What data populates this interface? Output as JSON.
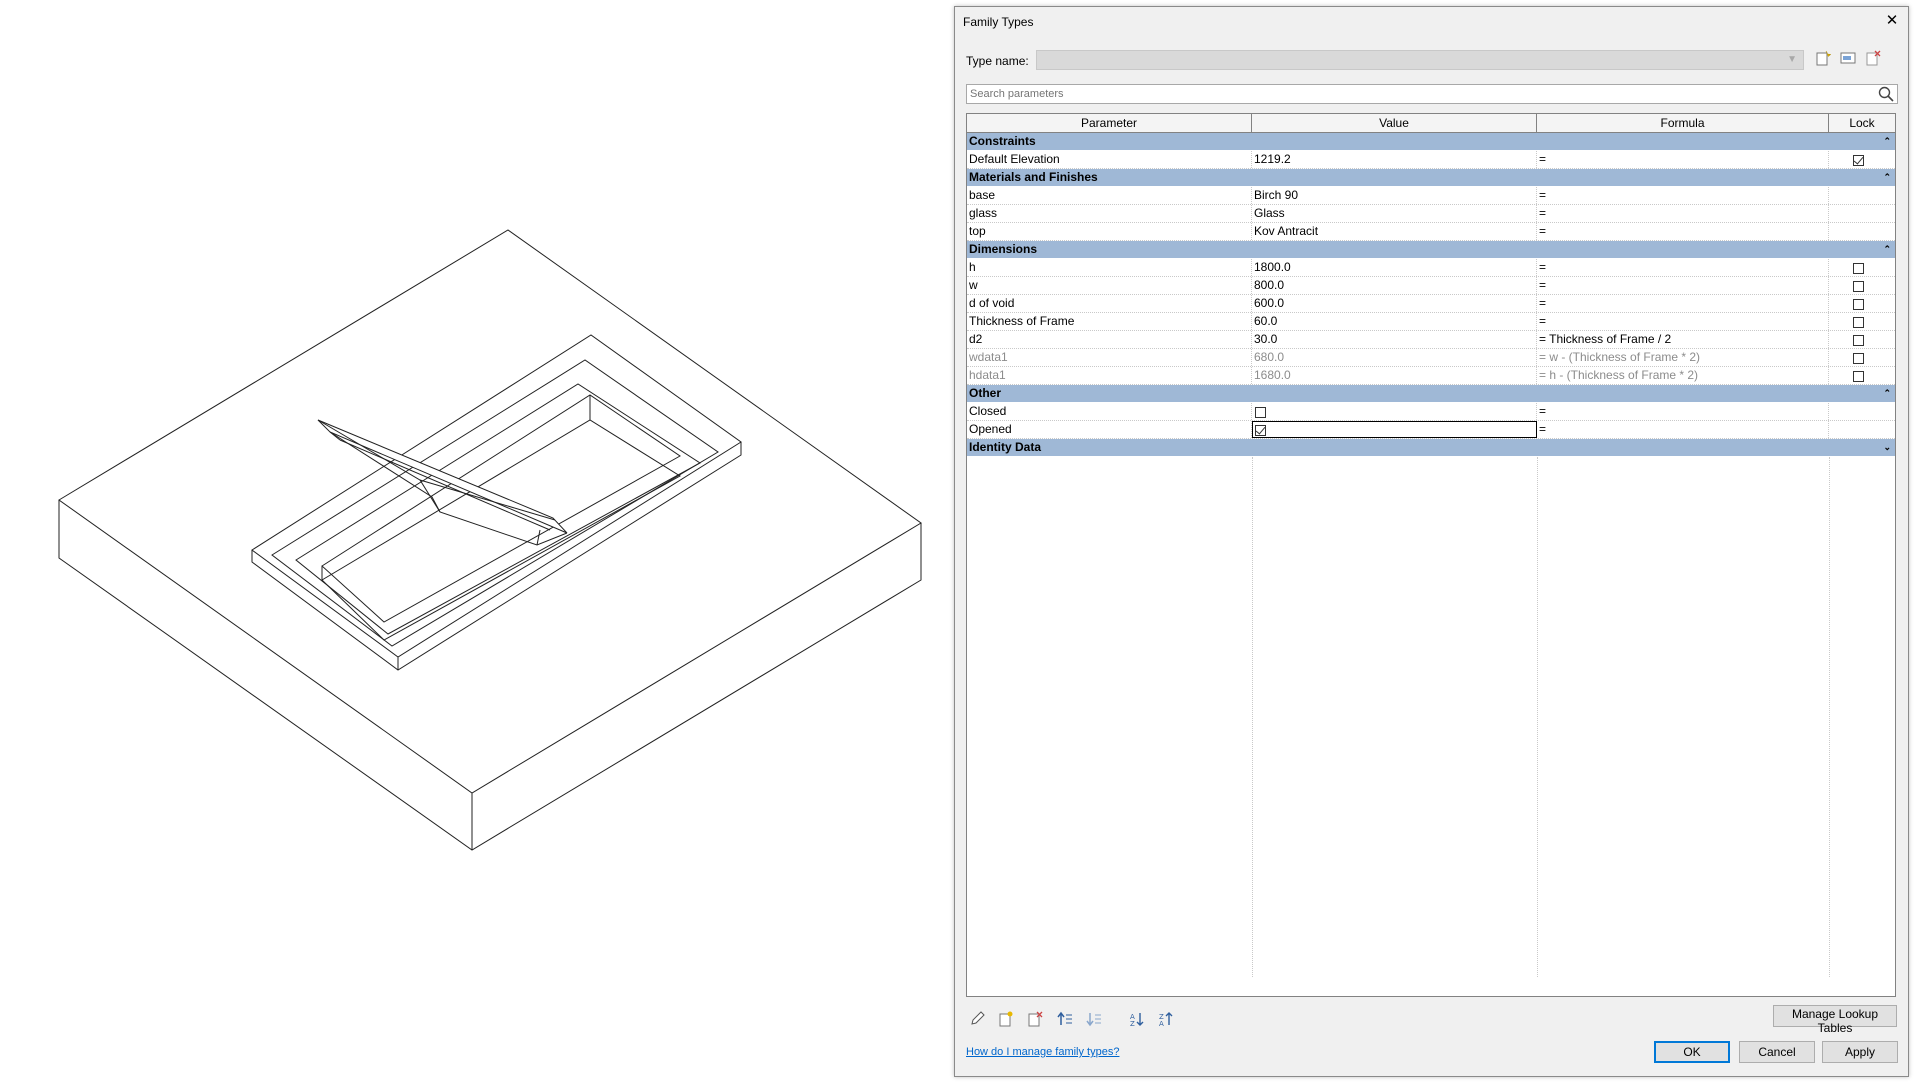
{
  "dialog": {
    "title": "Family Types",
    "close_glyph": "✕",
    "type_name_label": "Type name:",
    "type_name_value": "",
    "search_placeholder": "Search parameters"
  },
  "columns": [
    "Parameter",
    "Value",
    "Formula",
    "Lock"
  ],
  "groups": [
    {
      "name": "Constraints",
      "collapsed": false,
      "rows": [
        {
          "param": "Default Elevation",
          "value": "1219.2",
          "formula": "=",
          "lock": "checked",
          "dim": false
        }
      ]
    },
    {
      "name": "Materials and Finishes",
      "collapsed": false,
      "rows": [
        {
          "param": "base",
          "value": "Birch 90",
          "formula": "=",
          "lock": "none",
          "dim": false
        },
        {
          "param": "glass",
          "value": "Glass",
          "formula": "=",
          "lock": "none",
          "dim": false
        },
        {
          "param": "top",
          "value": "Kov Antracit",
          "formula": "=",
          "lock": "none",
          "dim": false
        }
      ]
    },
    {
      "name": "Dimensions",
      "collapsed": false,
      "rows": [
        {
          "param": "h",
          "value": "1800.0",
          "formula": "=",
          "lock": "unchecked",
          "dim": false
        },
        {
          "param": "w",
          "value": "800.0",
          "formula": "=",
          "lock": "unchecked",
          "dim": false
        },
        {
          "param": "d of void",
          "value": "600.0",
          "formula": "=",
          "lock": "unchecked",
          "dim": false
        },
        {
          "param": "Thickness of Frame",
          "value": "60.0",
          "formula": "=",
          "lock": "unchecked",
          "dim": false
        },
        {
          "param": "d2",
          "value": "30.0",
          "formula": "= Thickness of Frame / 2",
          "lock": "unchecked",
          "dim": false
        },
        {
          "param": "wdata1",
          "value": "680.0",
          "formula": "= w - (Thickness of Frame * 2)",
          "lock": "unchecked",
          "dim": true
        },
        {
          "param": "hdata1",
          "value": "1680.0",
          "formula": "= h - (Thickness of Frame * 2)",
          "lock": "unchecked",
          "dim": true
        }
      ]
    },
    {
      "name": "Other",
      "collapsed": false,
      "rows": [
        {
          "param": "Closed",
          "value_checkbox": "unchecked",
          "formula": "=",
          "lock": "none",
          "dim": false
        },
        {
          "param": "Opened",
          "value_checkbox": "checked",
          "formula": "=",
          "lock": "none",
          "dim": false,
          "selected": true
        }
      ]
    },
    {
      "name": "Identity Data",
      "collapsed": true,
      "rows": []
    }
  ],
  "toggle_glyphs": {
    "expanded": "⌃",
    "collapsed": "⌄"
  },
  "buttons": {
    "manage_lookup": "Manage Lookup Tables",
    "ok": "OK",
    "cancel": "Cancel",
    "apply": "Apply"
  },
  "help_link": "How do I manage family types?",
  "icons": {
    "new_type": "new-type-icon",
    "rename_type": "rename-type-icon",
    "delete_type": "delete-type-icon",
    "edit_param": "pencil-icon",
    "new_param": "new-parameter-icon",
    "delete_param": "delete-parameter-icon",
    "move_up": "move-up-icon",
    "move_down": "move-down-icon",
    "sort_asc": "sort-ascending-icon",
    "sort_desc": "sort-descending-icon"
  },
  "colors": {
    "group_header": "#9fb8d6",
    "link": "#0066cc",
    "accent": "#0078d7"
  }
}
